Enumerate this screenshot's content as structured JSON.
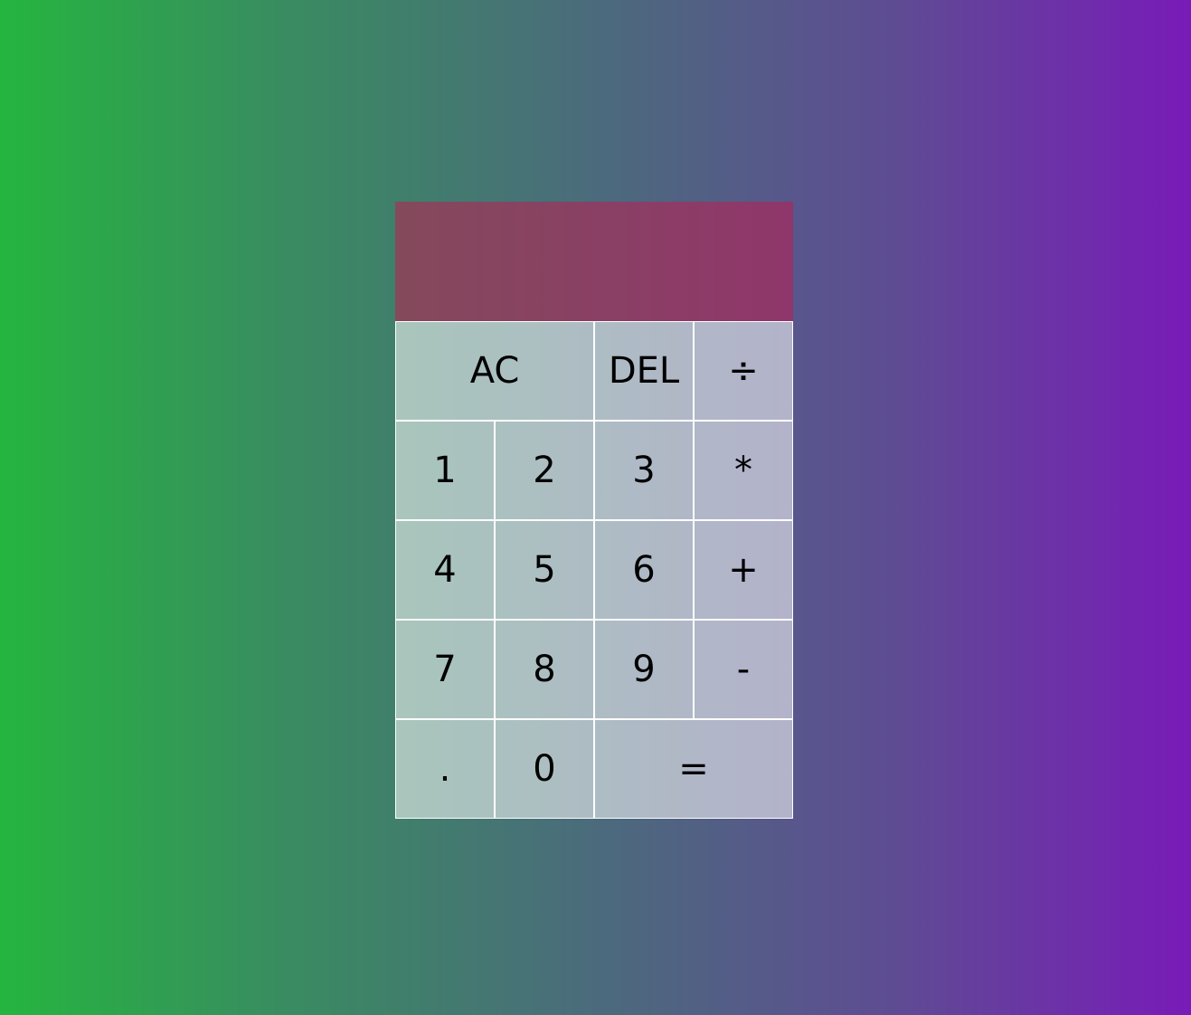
{
  "display": {
    "previous_operand": "",
    "current_operand": ""
  },
  "keys": {
    "clear": "AC",
    "delete": "DEL",
    "divide": "÷",
    "one": "1",
    "two": "2",
    "three": "3",
    "multiply": "*",
    "four": "4",
    "five": "5",
    "six": "6",
    "add": "+",
    "seven": "7",
    "eight": "8",
    "nine": "9",
    "subtract": "-",
    "decimal": ".",
    "zero": "0",
    "equals": "="
  },
  "colors": {
    "background_left": "#25b53f",
    "background_right": "#781bb8",
    "display_bg": "#8c3c74",
    "key_bg": "#a6bbb8",
    "key_border": "#ffffff"
  }
}
